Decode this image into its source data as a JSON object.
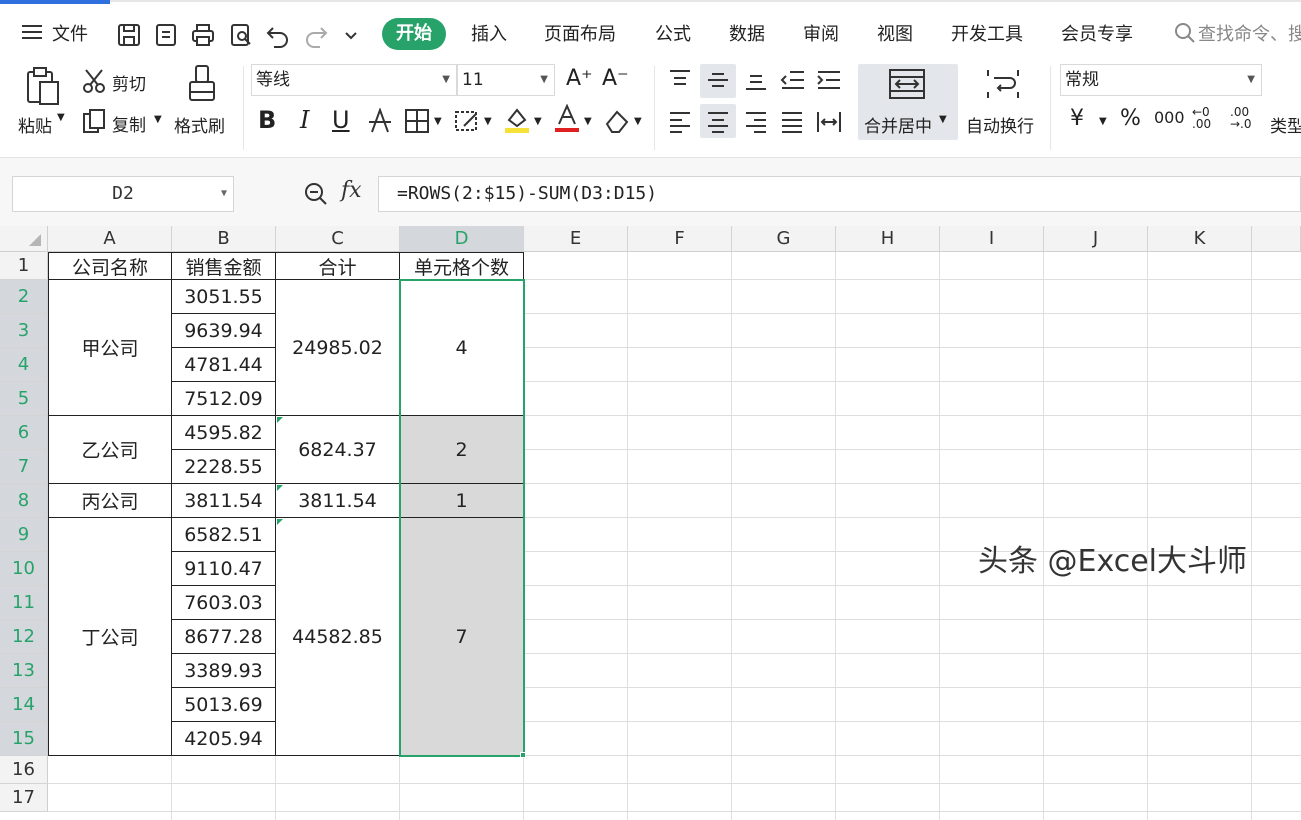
{
  "menu": {
    "file": "文件",
    "active_tab": "开始",
    "tabs": [
      "插入",
      "页面布局",
      "公式",
      "数据",
      "审阅",
      "视图",
      "开发工具",
      "会员专享"
    ],
    "search": "查找命令、搜"
  },
  "ribbon": {
    "paste": "粘贴",
    "cut": "剪切",
    "copy": "复制",
    "format_painter": "格式刷",
    "font_name": "等线",
    "font_size": "11",
    "bold": "B",
    "italic": "I",
    "underline": "U",
    "merge_center": "合并居中",
    "wrap_text": "自动换行",
    "number_format": "常规",
    "currency": "¥",
    "percent": "%",
    "thousands": "000",
    "type_convert": "类型"
  },
  "formula_bar": {
    "name_box": "D2",
    "fx": "fx",
    "formula": "=ROWS(2:$15)-SUM(D3:D15)"
  },
  "sheet": {
    "columns": [
      "A",
      "B",
      "C",
      "D",
      "E",
      "F",
      "G",
      "H",
      "I",
      "J",
      "K"
    ],
    "selected_column": "D",
    "rows": [
      "1",
      "2",
      "3",
      "4",
      "5",
      "6",
      "7",
      "8",
      "9",
      "10",
      "11",
      "12",
      "13",
      "14",
      "15",
      "16",
      "17"
    ],
    "headers": [
      "公司名称",
      "销售金额",
      "合计",
      "单元格个数"
    ],
    "companies": [
      "甲公司",
      "乙公司",
      "丙公司",
      "丁公司"
    ],
    "sales": [
      "3051.55",
      "9639.94",
      "4781.44",
      "7512.09",
      "4595.82",
      "2228.55",
      "3811.54",
      "6582.51",
      "9110.47",
      "7603.03",
      "8677.28",
      "3389.93",
      "5013.69",
      "4205.94"
    ],
    "totals": [
      "24985.02",
      "6824.37",
      "3811.54",
      "44582.85"
    ],
    "counts": [
      "4",
      "2",
      "1",
      "7"
    ]
  },
  "watermark": "头条 @Excel大斗师",
  "colors": {
    "accent": "#27a36a",
    "tab_active": "#27a36a",
    "selection_fill": "#d9d9d9",
    "brand_blue": "#2f6fde"
  }
}
